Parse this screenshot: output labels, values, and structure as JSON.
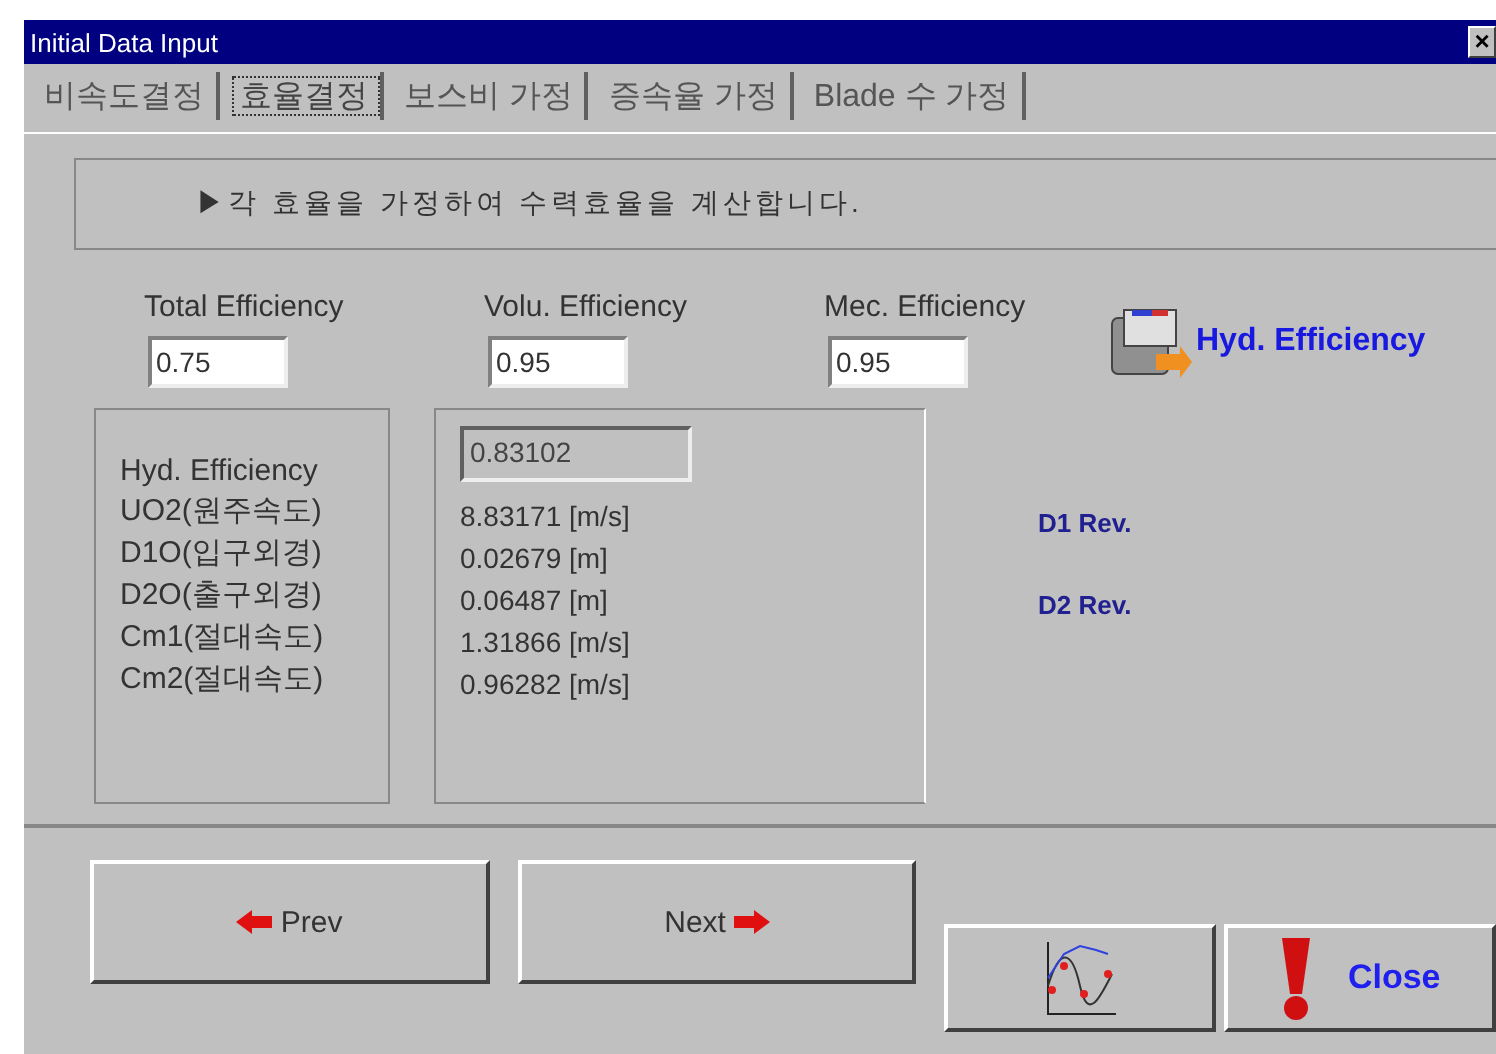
{
  "window": {
    "title": "Initial Data Input",
    "close": "×"
  },
  "tabs": [
    {
      "label": "비속도결정",
      "selected": false
    },
    {
      "label": "효율결정",
      "selected": true
    },
    {
      "label": "보스비 가정",
      "selected": false
    },
    {
      "label": "증속율 가정",
      "selected": false
    },
    {
      "label": "Blade 수 가정",
      "selected": false
    }
  ],
  "instruction": "▶각 효율을 가정하여 수력효율을 계산합니다.",
  "inputs": [
    {
      "label": "Total Efficiency",
      "value": "0.75"
    },
    {
      "label": "Volu. Efficiency",
      "value": "0.95"
    },
    {
      "label": "Mec. Efficiency",
      "value": "0.95"
    }
  ],
  "hyd_button": "Hyd. Efficiency",
  "result_labels": [
    "Hyd. Efficiency",
    "UO2(원주속도)",
    "D1O(입구외경)",
    "D2O(출구외경)",
    "Cm1(절대속도)",
    "Cm2(절대속도)"
  ],
  "result_field": "0.83102",
  "result_values": [
    "8.83171 [m/s]",
    "0.02679 [m]",
    "0.06487 [m]",
    "1.31866 [m/s]",
    "0.96282 [m/s]"
  ],
  "revisions": [
    "D1 Rev.",
    "D2 Rev."
  ],
  "buttons": {
    "prev": "Prev",
    "next": "Next",
    "close": "Close"
  }
}
